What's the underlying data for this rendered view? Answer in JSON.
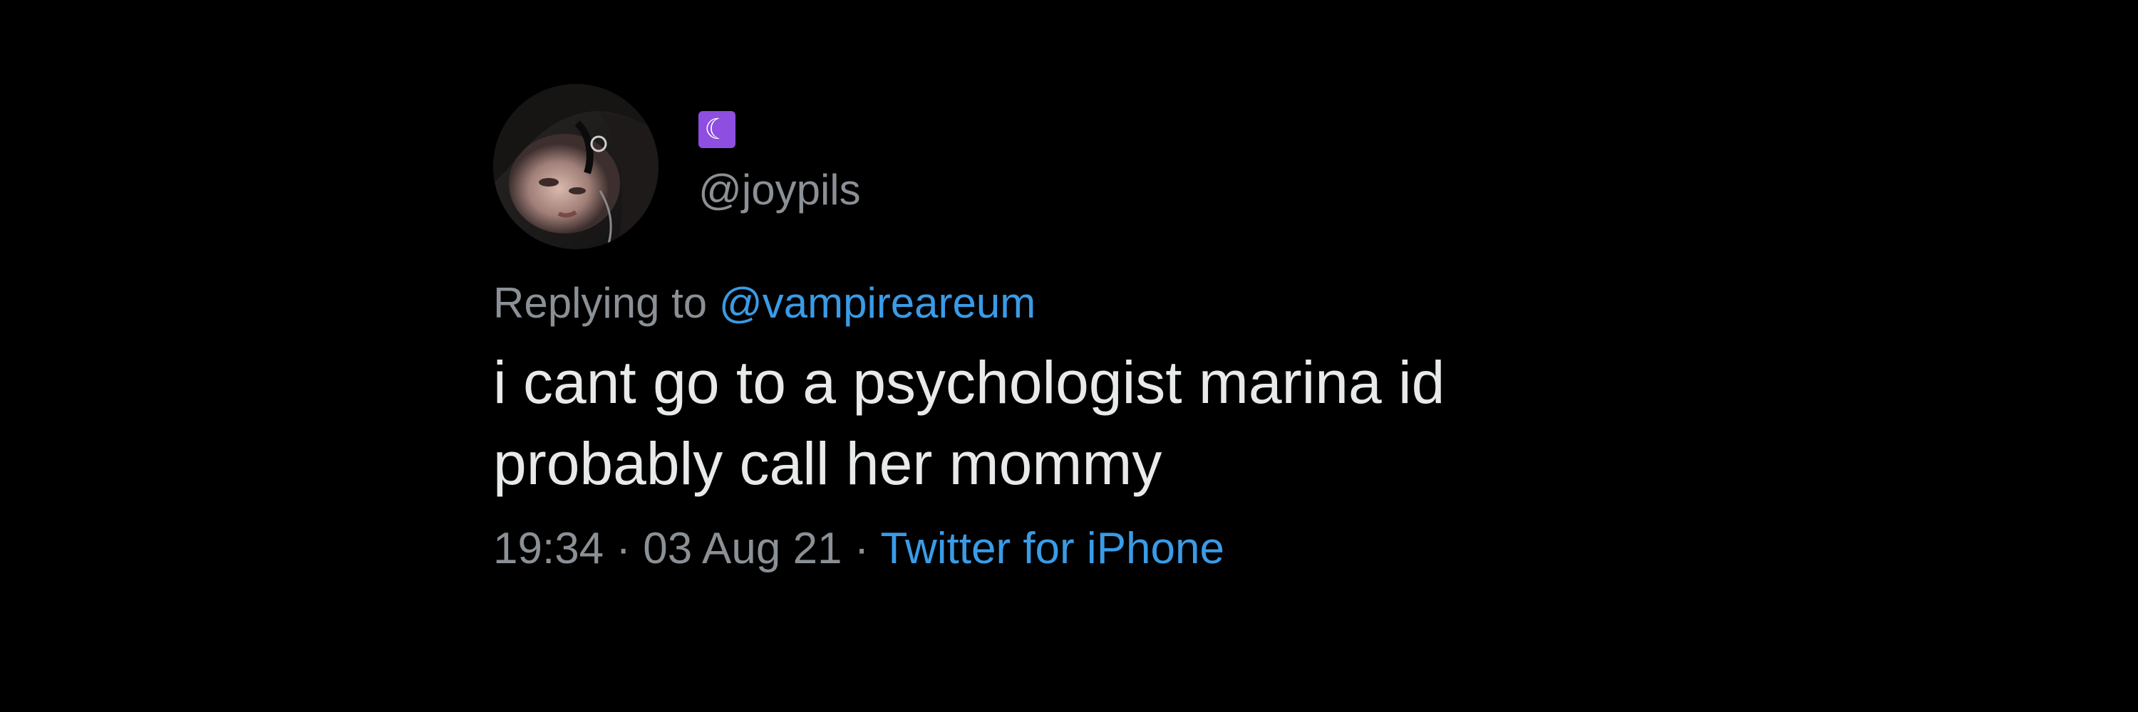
{
  "tweet": {
    "name_emoji": "☾",
    "handle": "@joypils",
    "replying_prefix": "Replying to ",
    "replying_to": "@vampireareum",
    "text_line1": "i cant go to a psychologist marina id",
    "text_line2": "probably call her mommy",
    "time": "19:34",
    "date": "03 Aug 21",
    "separator": " · ",
    "source": "Twitter for iPhone"
  },
  "icons": {
    "avatar": "profile-photo",
    "name_emoji": "crescent-moon-emoji"
  },
  "colors": {
    "background": "#000000",
    "text_primary": "#E7E9EA",
    "text_secondary": "#8B9096",
    "link": "#3A9BE6",
    "emoji_bg": "#8E4EE0"
  }
}
